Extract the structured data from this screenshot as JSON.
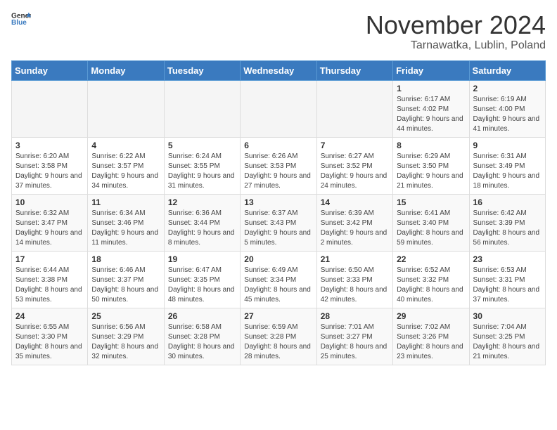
{
  "header": {
    "logo_general": "General",
    "logo_blue": "Blue",
    "month_title": "November 2024",
    "location": "Tarnawatka, Lublin, Poland"
  },
  "weekdays": [
    "Sunday",
    "Monday",
    "Tuesday",
    "Wednesday",
    "Thursday",
    "Friday",
    "Saturday"
  ],
  "weeks": [
    [
      {
        "day": "",
        "info": ""
      },
      {
        "day": "",
        "info": ""
      },
      {
        "day": "",
        "info": ""
      },
      {
        "day": "",
        "info": ""
      },
      {
        "day": "",
        "info": ""
      },
      {
        "day": "1",
        "info": "Sunrise: 6:17 AM\nSunset: 4:02 PM\nDaylight: 9 hours and 44 minutes."
      },
      {
        "day": "2",
        "info": "Sunrise: 6:19 AM\nSunset: 4:00 PM\nDaylight: 9 hours and 41 minutes."
      }
    ],
    [
      {
        "day": "3",
        "info": "Sunrise: 6:20 AM\nSunset: 3:58 PM\nDaylight: 9 hours and 37 minutes."
      },
      {
        "day": "4",
        "info": "Sunrise: 6:22 AM\nSunset: 3:57 PM\nDaylight: 9 hours and 34 minutes."
      },
      {
        "day": "5",
        "info": "Sunrise: 6:24 AM\nSunset: 3:55 PM\nDaylight: 9 hours and 31 minutes."
      },
      {
        "day": "6",
        "info": "Sunrise: 6:26 AM\nSunset: 3:53 PM\nDaylight: 9 hours and 27 minutes."
      },
      {
        "day": "7",
        "info": "Sunrise: 6:27 AM\nSunset: 3:52 PM\nDaylight: 9 hours and 24 minutes."
      },
      {
        "day": "8",
        "info": "Sunrise: 6:29 AM\nSunset: 3:50 PM\nDaylight: 9 hours and 21 minutes."
      },
      {
        "day": "9",
        "info": "Sunrise: 6:31 AM\nSunset: 3:49 PM\nDaylight: 9 hours and 18 minutes."
      }
    ],
    [
      {
        "day": "10",
        "info": "Sunrise: 6:32 AM\nSunset: 3:47 PM\nDaylight: 9 hours and 14 minutes."
      },
      {
        "day": "11",
        "info": "Sunrise: 6:34 AM\nSunset: 3:46 PM\nDaylight: 9 hours and 11 minutes."
      },
      {
        "day": "12",
        "info": "Sunrise: 6:36 AM\nSunset: 3:44 PM\nDaylight: 9 hours and 8 minutes."
      },
      {
        "day": "13",
        "info": "Sunrise: 6:37 AM\nSunset: 3:43 PM\nDaylight: 9 hours and 5 minutes."
      },
      {
        "day": "14",
        "info": "Sunrise: 6:39 AM\nSunset: 3:42 PM\nDaylight: 9 hours and 2 minutes."
      },
      {
        "day": "15",
        "info": "Sunrise: 6:41 AM\nSunset: 3:40 PM\nDaylight: 8 hours and 59 minutes."
      },
      {
        "day": "16",
        "info": "Sunrise: 6:42 AM\nSunset: 3:39 PM\nDaylight: 8 hours and 56 minutes."
      }
    ],
    [
      {
        "day": "17",
        "info": "Sunrise: 6:44 AM\nSunset: 3:38 PM\nDaylight: 8 hours and 53 minutes."
      },
      {
        "day": "18",
        "info": "Sunrise: 6:46 AM\nSunset: 3:37 PM\nDaylight: 8 hours and 50 minutes."
      },
      {
        "day": "19",
        "info": "Sunrise: 6:47 AM\nSunset: 3:35 PM\nDaylight: 8 hours and 48 minutes."
      },
      {
        "day": "20",
        "info": "Sunrise: 6:49 AM\nSunset: 3:34 PM\nDaylight: 8 hours and 45 minutes."
      },
      {
        "day": "21",
        "info": "Sunrise: 6:50 AM\nSunset: 3:33 PM\nDaylight: 8 hours and 42 minutes."
      },
      {
        "day": "22",
        "info": "Sunrise: 6:52 AM\nSunset: 3:32 PM\nDaylight: 8 hours and 40 minutes."
      },
      {
        "day": "23",
        "info": "Sunrise: 6:53 AM\nSunset: 3:31 PM\nDaylight: 8 hours and 37 minutes."
      }
    ],
    [
      {
        "day": "24",
        "info": "Sunrise: 6:55 AM\nSunset: 3:30 PM\nDaylight: 8 hours and 35 minutes."
      },
      {
        "day": "25",
        "info": "Sunrise: 6:56 AM\nSunset: 3:29 PM\nDaylight: 8 hours and 32 minutes."
      },
      {
        "day": "26",
        "info": "Sunrise: 6:58 AM\nSunset: 3:28 PM\nDaylight: 8 hours and 30 minutes."
      },
      {
        "day": "27",
        "info": "Sunrise: 6:59 AM\nSunset: 3:28 PM\nDaylight: 8 hours and 28 minutes."
      },
      {
        "day": "28",
        "info": "Sunrise: 7:01 AM\nSunset: 3:27 PM\nDaylight: 8 hours and 25 minutes."
      },
      {
        "day": "29",
        "info": "Sunrise: 7:02 AM\nSunset: 3:26 PM\nDaylight: 8 hours and 23 minutes."
      },
      {
        "day": "30",
        "info": "Sunrise: 7:04 AM\nSunset: 3:25 PM\nDaylight: 8 hours and 21 minutes."
      }
    ]
  ]
}
